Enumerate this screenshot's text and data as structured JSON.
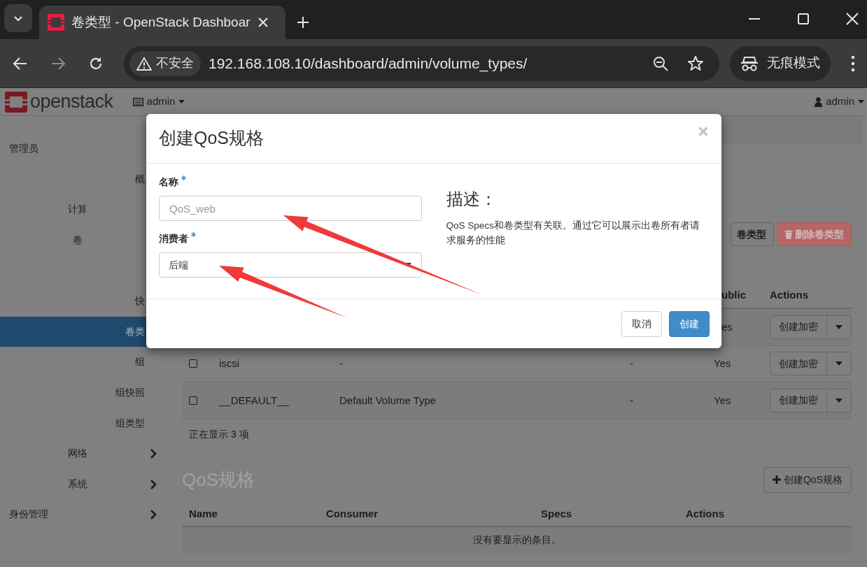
{
  "browser": {
    "tab_title": "卷类型 - OpenStack Dashboar",
    "security_label": "不安全",
    "url": "192.168.108.10/dashboard/admin/volume_types/",
    "incognito_label": "无痕模式"
  },
  "header": {
    "logo_text": "openstack",
    "project_menu": "admin",
    "user_menu": "admin"
  },
  "sidebar": [
    {
      "label": "管理员",
      "kind": "group",
      "children": [
        {
          "label": "概",
          "selected": false
        },
        {
          "label": "计算",
          "kind": "group"
        },
        {
          "label": "卷",
          "kind": "group",
          "children": [
            {
              "label": "快",
              "selected": false
            },
            {
              "label": "卷类",
              "selected": true
            },
            {
              "label": "组",
              "selected": false
            },
            {
              "label": "组快照",
              "selected": false
            },
            {
              "label": "组类型",
              "selected": false
            }
          ]
        },
        {
          "label": "网络",
          "kind": "group",
          "expanded": false
        },
        {
          "label": "系统",
          "kind": "group",
          "expanded": false
        }
      ]
    },
    {
      "label": "身份管理",
      "kind": "group",
      "expanded": false
    }
  ],
  "volume_types": {
    "toolbar_buttons": [
      {
        "label": "卷类型",
        "kind": "default",
        "disabled": false
      },
      {
        "label": "删除卷类型",
        "kind": "danger",
        "disabled": true
      }
    ],
    "header": {
      "column_5": "ublic",
      "actions": "Actions"
    },
    "rows": [
      {
        "public": "es",
        "action": "创建加密"
      },
      {
        "checked": false,
        "name": "iscsi",
        "description": "-",
        "column_4": "-",
        "public": "Yes",
        "action": "创建加密"
      },
      {
        "checked": false,
        "name": "__DEFAULT__",
        "description": "Default Volume Type",
        "column_4": "-",
        "public": "Yes",
        "action": "创建加密"
      }
    ],
    "footer": "正在显示 3 项"
  },
  "qos_specs": {
    "title": "QoS规格",
    "create_button": "创建QoS规格",
    "columns": [
      "Name",
      "Consumer",
      "Specs",
      "Actions"
    ],
    "empty_message": "没有要显示的条目。"
  },
  "modal": {
    "title": "创建QoS规格",
    "fields": [
      {
        "label": "名称",
        "required": true,
        "kind": "text",
        "placeholder": "QoS_web"
      },
      {
        "label": "消费者",
        "required": true,
        "kind": "select",
        "value": "后端"
      }
    ],
    "description_title": "描述：",
    "description": "QoS Specs和卷类型有关联。通过它可以展示出卷所有者请求服务的性能",
    "buttons": [
      {
        "label": "取消",
        "kind": "default"
      },
      {
        "label": "创建",
        "kind": "primary"
      }
    ]
  }
}
